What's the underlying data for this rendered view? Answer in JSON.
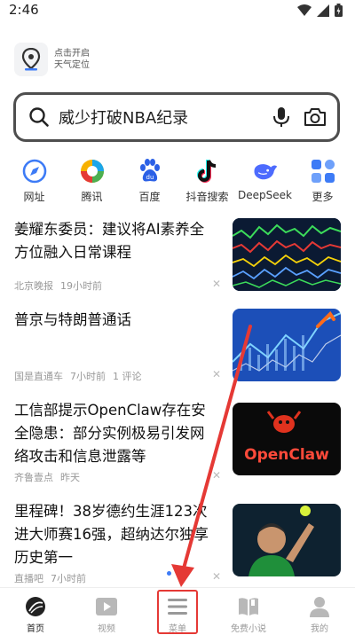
{
  "status_bar": {
    "time": "2:46"
  },
  "weather": {
    "line1": "点击开启",
    "line2": "天气定位"
  },
  "search": {
    "query": "威少打破NBA纪录"
  },
  "shortcuts": [
    {
      "label": "网址",
      "icon": "compass-icon"
    },
    {
      "label": "腾讯",
      "icon": "tencent-icon"
    },
    {
      "label": "百度",
      "icon": "baidu-icon"
    },
    {
      "label": "抖音搜索",
      "icon": "douyin-icon"
    },
    {
      "label": "DeepSeek",
      "icon": "deepseek-icon"
    },
    {
      "label": "更多",
      "icon": "more-grid-icon"
    }
  ],
  "feed": [
    {
      "title": "姜耀东委员：建议将AI素养全方位融入日常课程",
      "source": "北京晚报",
      "time": "19小时前",
      "comments": ""
    },
    {
      "title": "普京与特朗普通话",
      "source": "国是直通车",
      "time": "7小时前",
      "comments": "1 评论"
    },
    {
      "title": "工信部提示OpenClaw存在安全隐患：部分实例极易引发网络攻击和信息泄露等",
      "source": "齐鲁壹点",
      "time": "昨天",
      "comments": ""
    },
    {
      "title": "里程碑！38岁德约生涯123次进大师赛16强，超纳达尔独享历史第一",
      "source": "直播吧",
      "time": "7小时前",
      "comments": ""
    }
  ],
  "thumbs": {
    "openclaw_text": "OpenClaw"
  },
  "bottom_nav": [
    {
      "label": "首页",
      "icon": "home-icon",
      "active": true
    },
    {
      "label": "视频",
      "icon": "video-icon",
      "active": false
    },
    {
      "label": "菜单",
      "icon": "menu-icon",
      "active": false
    },
    {
      "label": "免费小说",
      "icon": "book-icon",
      "active": false
    },
    {
      "label": "我的",
      "icon": "profile-icon",
      "active": false
    }
  ],
  "colors": {
    "highlight": "#e53935",
    "accent": "#3d7bf6"
  }
}
